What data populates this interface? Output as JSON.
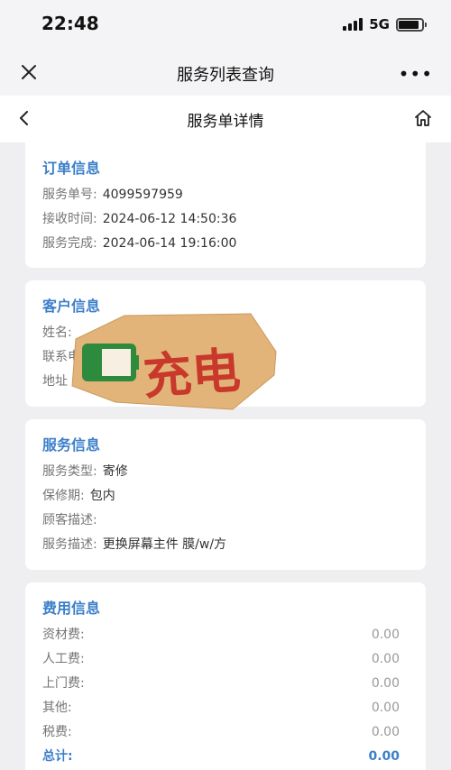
{
  "status_bar": {
    "time": "22:48",
    "network": "5G"
  },
  "mini_nav": {
    "title": "服务列表查询",
    "more": "•••"
  },
  "page_nav": {
    "title": "服务单详情"
  },
  "order_info": {
    "title": "订单信息",
    "rows": [
      {
        "label": "服务单号:",
        "value": "4099597959"
      },
      {
        "label": "接收时间:",
        "value": "2024-06-12 14:50:36"
      },
      {
        "label": "服务完成:",
        "value": "2024-06-14 19:16:00"
      }
    ]
  },
  "customer_info": {
    "title": "客户信息",
    "rows": [
      {
        "label": "姓名:",
        "value": ""
      },
      {
        "label": "联系电",
        "value": ""
      },
      {
        "label": "地址",
        "value": ""
      }
    ]
  },
  "service_info": {
    "title": "服务信息",
    "rows": [
      {
        "label": "服务类型:",
        "value": "寄修"
      },
      {
        "label": "保修期:",
        "value": "包内"
      },
      {
        "label": "顾客描述:",
        "value": ""
      },
      {
        "label": "服务描述:",
        "value": "更换屏幕主件 膜/w/方"
      }
    ]
  },
  "fee_info": {
    "title": "费用信息",
    "rows": [
      {
        "label": "资材费:",
        "value": "0.00"
      },
      {
        "label": "人工费:",
        "value": "0.00"
      },
      {
        "label": "上门费:",
        "value": "0.00"
      },
      {
        "label": "其他:",
        "value": "0.00"
      },
      {
        "label": "税费:",
        "value": "0.00"
      }
    ],
    "total": {
      "label": "总计:",
      "value": "0.00"
    }
  },
  "sticker": {
    "text": "充电",
    "battery_color": "#2e8b3e",
    "text_color": "#c8382b",
    "paper_color": "#e2b47a"
  },
  "colors": {
    "accent": "#3c7fca",
    "background": "#efeff2"
  }
}
